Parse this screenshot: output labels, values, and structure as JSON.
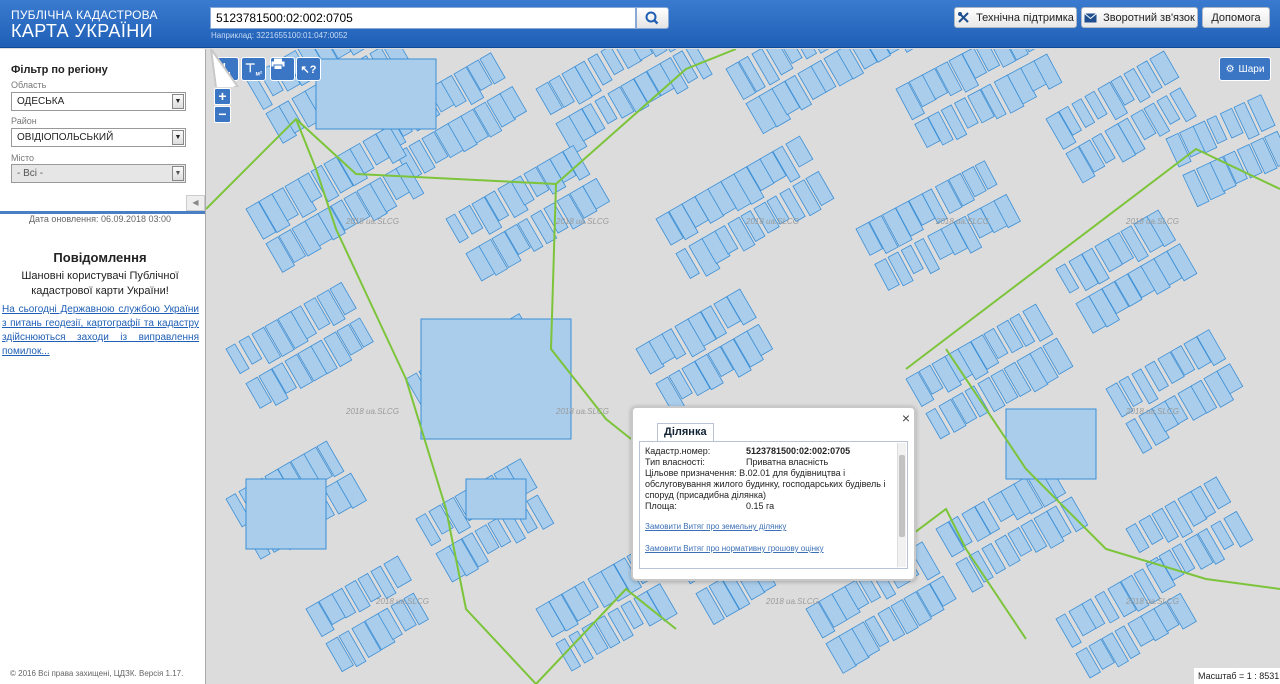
{
  "header": {
    "logo_line1": "ПУБЛІЧНА КАДАСТРОВА",
    "logo_line2": "КАРТА УКРАЇНИ",
    "search_value": "5123781500:02:002:0705",
    "search_hint": "Наприклад: 3221655100:01:047:0052",
    "support_label": "Технічна підтримка",
    "feedback_label": "Зворотний зв'язок",
    "help_label": "Допомога"
  },
  "sidebar": {
    "filter_title": "Фільтр по регіону",
    "oblast_label": "Область",
    "oblast_value": "ОДЕСЬКА",
    "raion_label": "Район",
    "raion_value": "ОВІДІОПОЛЬСЬКИЙ",
    "city_label": "Місто",
    "city_value": "- Всі -",
    "update_date": "Дата оновлення: 06.09.2018 03:00",
    "news_title": "Повідомлення",
    "news_subtitle": "Шановні користувачі Публічної кадастрової карти України!",
    "news_link": "На сьогодні Державною службою України з питань геодезії, картографії та кадастру здійснюються заходи із виправлення помилок...",
    "copyright": "© 2016 Всі права захищені, ЦДЗК. Версія 1.17."
  },
  "map": {
    "layers_label": "Шари",
    "zoom_in": "+",
    "zoom_out": "−",
    "scale": "Масштаб = 1 : 8531",
    "watermark": "2018 ua.SLCG"
  },
  "popup": {
    "tab": "Ділянка",
    "close": "×",
    "rows": [
      {
        "label": "Кадастр.номер:",
        "value": "5123781500:02:002:0705"
      },
      {
        "label": "Тип власності:",
        "value": "Приватна власність"
      },
      {
        "label": "Цільове призначення:",
        "value": "В.02.01 для будівництва і обслуговування жилого будинку, господарських будівель і споруд (присадибна ділянка)"
      },
      {
        "label": "Площа:",
        "value": "0.15 га"
      }
    ],
    "link1": "Замовити Витяг про земельну ділянку",
    "link2": "Замовити Витяг про нормативну грошову оцінку"
  },
  "colors": {
    "header": "#1f5fb5",
    "parcel_fill": "#a9cdea",
    "parcel_stroke": "#3d8fd6",
    "boundary": "#7cc43a"
  }
}
